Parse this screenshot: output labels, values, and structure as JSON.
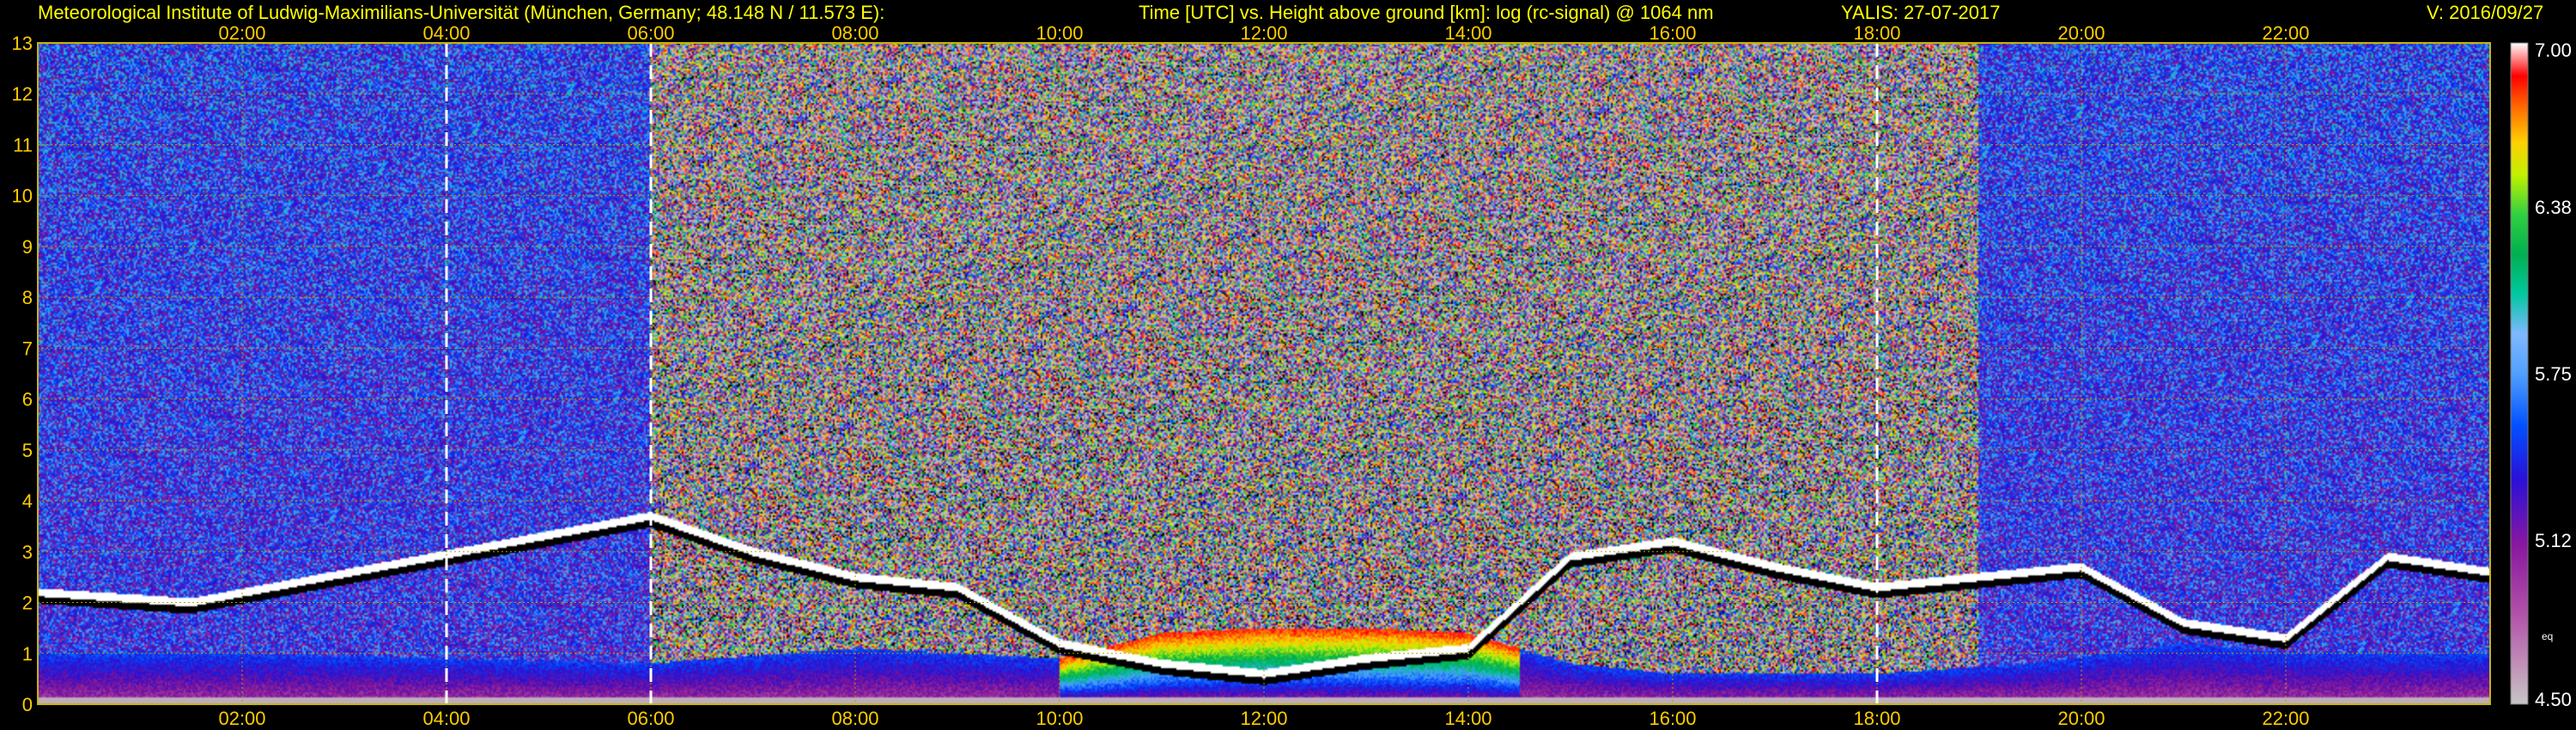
{
  "header": {
    "institute": "Meteorological Institute of Ludwig-Maximilians-Universität (München, Germany; 48.148 N / 11.573 E):",
    "plot_title": "Time [UTC] vs. Height above ground [km]: log (rc-signal) @ 1064 nm",
    "station_date": "YALIS: 27-07-2017",
    "version": "V: 2016/09/27"
  },
  "chart_data": {
    "type": "heatmap",
    "title": "Time [UTC] vs. Height above ground [km]: log (rc-signal) @ 1064 nm",
    "x_ticks": [
      "02:00",
      "04:00",
      "06:00",
      "08:00",
      "10:00",
      "12:00",
      "14:00",
      "16:00",
      "18:00",
      "20:00",
      "22:00"
    ],
    "x_tick_hours": [
      2,
      4,
      6,
      8,
      10,
      12,
      14,
      16,
      18,
      20,
      22
    ],
    "xlim_hours": [
      0,
      24
    ],
    "y_ticks": [
      "0",
      "1",
      "2",
      "3",
      "4",
      "5",
      "6",
      "7",
      "8",
      "9",
      "10",
      "11",
      "12",
      "13"
    ],
    "ylim_km": [
      0,
      13
    ],
    "dashed_markers_hours": [
      4,
      6,
      18.0
    ],
    "colorbar": {
      "range": [
        4.5,
        7.0
      ],
      "tick_values": [
        7.0,
        6.38,
        5.75,
        5.12,
        4.5
      ],
      "tick_labels": [
        "7.00",
        "6.38",
        "5.75",
        "5.12",
        "4.50"
      ],
      "extra_label": "eq"
    },
    "features": {
      "aerosol_layer_top_km": [
        [
          0,
          1.0
        ],
        [
          2,
          1.0
        ],
        [
          4,
          0.9
        ],
        [
          6,
          0.8
        ],
        [
          8,
          1.1
        ],
        [
          10,
          0.9
        ],
        [
          11,
          1.4
        ],
        [
          12,
          1.5
        ],
        [
          13,
          1.5
        ],
        [
          14,
          1.4
        ],
        [
          15,
          0.8
        ],
        [
          16,
          0.6
        ],
        [
          18,
          0.6
        ],
        [
          19.5,
          0.8
        ],
        [
          21,
          1.2
        ],
        [
          22,
          1.0
        ],
        [
          24,
          1.0
        ]
      ],
      "cloud_layer_km": [
        [
          0,
          2.1
        ],
        [
          1.5,
          1.9
        ],
        [
          6,
          3.6
        ],
        [
          7,
          2.9
        ],
        [
          8,
          2.4
        ],
        [
          9,
          2.2
        ],
        [
          10,
          1.1
        ],
        [
          11,
          0.7
        ],
        [
          12,
          0.5
        ],
        [
          13,
          0.8
        ],
        [
          14,
          1.0
        ],
        [
          15,
          2.8
        ],
        [
          16,
          3.1
        ],
        [
          17,
          2.6
        ],
        [
          18,
          2.2
        ],
        [
          19,
          2.4
        ],
        [
          20,
          2.6
        ],
        [
          21,
          1.5
        ],
        [
          22,
          1.2
        ],
        [
          23,
          2.8
        ],
        [
          24,
          2.5
        ]
      ],
      "noise_onset_hour": 6
    },
    "colors": {
      "background": "#000000",
      "text": "#ffff00",
      "axis_text": "#ffcc00",
      "grid": "#b4a000",
      "dashed_marker": "#ffffff"
    }
  }
}
